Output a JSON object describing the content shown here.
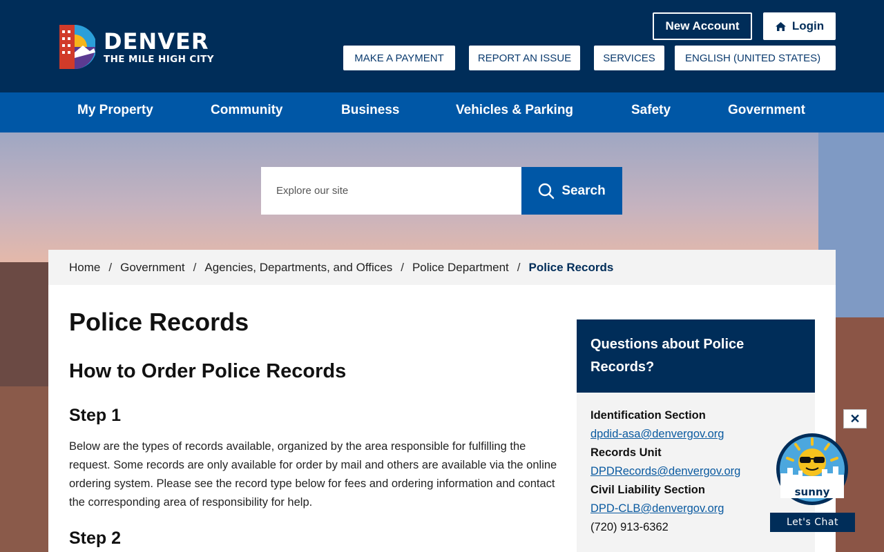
{
  "header": {
    "logo_title": "DENVER",
    "logo_subtitle": "THE MILE HIGH CITY",
    "new_account_label": "New Account",
    "login_label": "Login",
    "utility_links": [
      "MAKE A PAYMENT",
      "REPORT AN ISSUE",
      "SERVICES",
      "ENGLISH (UNITED STATES)"
    ]
  },
  "nav": {
    "items": [
      "My Property",
      "Community",
      "Business",
      "Vehicles & Parking",
      "Safety",
      "Government"
    ]
  },
  "search": {
    "placeholder": "Explore our site",
    "button_label": "Search"
  },
  "breadcrumb": {
    "items": [
      "Home",
      "Government",
      "Agencies, Departments, and Offices",
      "Police Department"
    ],
    "current": "Police Records",
    "separator": "/"
  },
  "main": {
    "title": "Police Records",
    "subtitle": "How to Order Police Records",
    "step1_heading": "Step 1",
    "step1_text": "Below are the types of records available, organized by the area responsible for fulfilling the request. Some records are only available for order by mail and others are available via the online ordering system. Please see the record type below for fees and ordering information and contact the corresponding area of responsibility for help.",
    "step2_heading": "Step 2"
  },
  "sidebar": {
    "heading": "Questions about Police Records?",
    "contacts": [
      {
        "label": "Identification Section",
        "email": "dpdid-asa@denvergov.org"
      },
      {
        "label": "Records Unit",
        "email": "DPDRecords@denvergov.org"
      },
      {
        "label": "Civil Liability Section",
        "email": "DPD-CLB@denvergov.org"
      }
    ],
    "phone": "(720) 913-6362"
  },
  "chat": {
    "bot_name": "sunny",
    "label": "Let's Chat",
    "close_symbol": "✕"
  },
  "colors": {
    "header_navy": "#002d59",
    "nav_blue": "#0057a6",
    "link_blue": "#0a5aa0",
    "breadcrumb_bg": "#f3f3f3"
  }
}
